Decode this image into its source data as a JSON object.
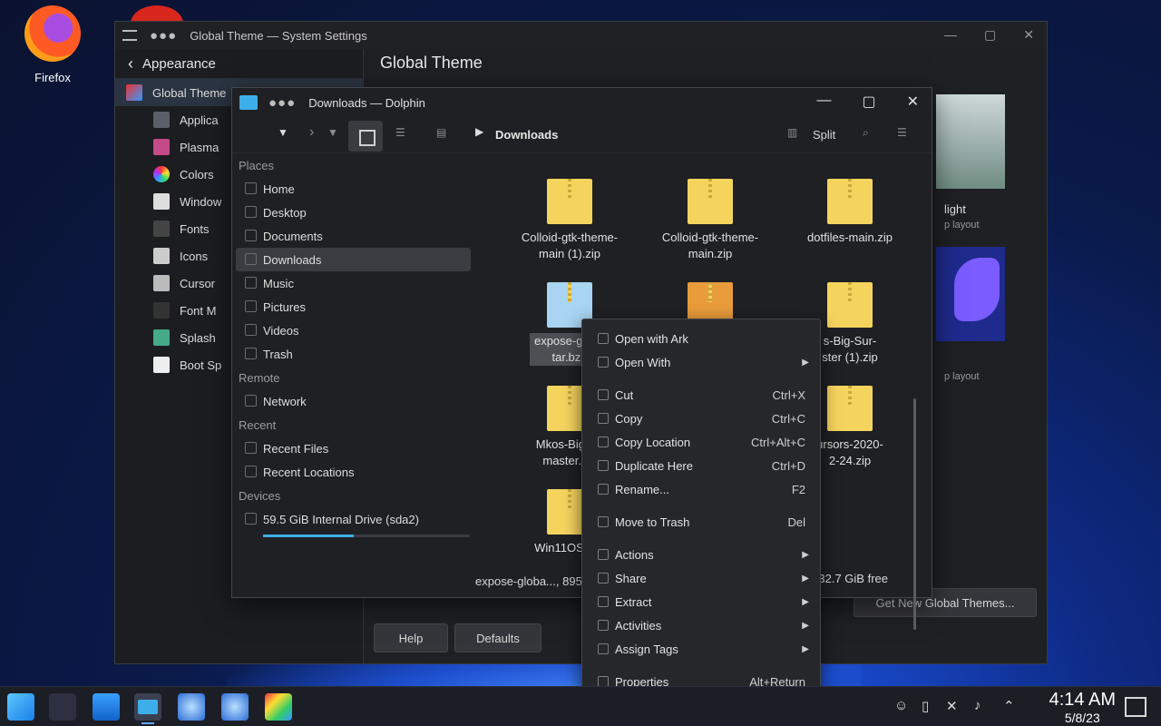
{
  "desktop": {
    "firefox_label": "Firefox"
  },
  "settings_window": {
    "title": "Global Theme — System Settings",
    "sidebar_header": "Appearance",
    "sidebar_items": [
      {
        "label": "Global Theme",
        "selected": true
      },
      {
        "label": "Applica"
      },
      {
        "label": "Plasma"
      },
      {
        "label": "Colors"
      },
      {
        "label": "Window"
      },
      {
        "label": "Fonts"
      },
      {
        "label": "Icons"
      },
      {
        "label": "Cursor"
      },
      {
        "label": "Font M"
      },
      {
        "label": "Splash"
      },
      {
        "label": "Boot Sp"
      }
    ],
    "page_title": "Global Theme",
    "theme1_name": "light",
    "theme1_sub": "p layout",
    "theme2_sub": "p layout",
    "get_new_button": "Get New Global Themes...",
    "help_button": "Help",
    "defaults_button": "Defaults"
  },
  "dolphin": {
    "title": "Downloads — Dolphin",
    "breadcrumb": "Downloads",
    "split_label": "Split",
    "places_header": "Places",
    "places": [
      "Home",
      "Desktop",
      "Documents",
      "Downloads",
      "Music",
      "Pictures",
      "Videos",
      "Trash"
    ],
    "remote_header": "Remote",
    "remote": [
      "Network"
    ],
    "recent_header": "Recent",
    "recent": [
      "Recent Files",
      "Recent Locations"
    ],
    "devices_header": "Devices",
    "devices": [
      "59.5 GiB Internal Drive (sda2)"
    ],
    "drive_usage_fraction": 0.44,
    "files": [
      {
        "line1": "Colloid-gtk-theme-",
        "line2": "main (1).zip"
      },
      {
        "line1": "Colloid-gtk-theme-",
        "line2": "main.zip"
      },
      {
        "line1": "dotfiles-main.zip",
        "line2": ""
      },
      {
        "line1": "expose-globa",
        "line2": "tar.bz2"
      },
      {
        "line1": "",
        "line2": ""
      },
      {
        "line1": "s-Big-Sur-",
        "line2": "ster (1).zip"
      },
      {
        "line1": "Mkos-Big-Su",
        "line2": "master.zip"
      },
      {
        "line1": "ursors-2020-",
        "line2": "2-24.zip"
      },
      {
        "line1": "Win11OS-dar",
        "line2": ""
      }
    ],
    "status_text": "expose-globa..., 895",
    "free_text": "32.7 GiB free"
  },
  "context_menu": {
    "items": [
      {
        "label": "Open with Ark",
        "shortcut": "",
        "submenu": false
      },
      {
        "label": "Open With",
        "shortcut": "",
        "submenu": true
      },
      {
        "label": "Cut",
        "shortcut": "Ctrl+X",
        "submenu": false
      },
      {
        "label": "Copy",
        "shortcut": "Ctrl+C",
        "submenu": false
      },
      {
        "label": "Copy Location",
        "shortcut": "Ctrl+Alt+C",
        "submenu": false
      },
      {
        "label": "Duplicate Here",
        "shortcut": "Ctrl+D",
        "submenu": false
      },
      {
        "label": "Rename...",
        "shortcut": "F2",
        "submenu": false
      },
      {
        "label": "Move to Trash",
        "shortcut": "Del",
        "submenu": false
      },
      {
        "label": "Actions",
        "shortcut": "",
        "submenu": true
      },
      {
        "label": "Share",
        "shortcut": "",
        "submenu": true
      },
      {
        "label": "Extract",
        "shortcut": "",
        "submenu": true
      },
      {
        "label": "Activities",
        "shortcut": "",
        "submenu": true
      },
      {
        "label": "Assign Tags",
        "shortcut": "",
        "submenu": true
      },
      {
        "label": "Properties",
        "shortcut": "Alt+Return",
        "submenu": false
      }
    ]
  },
  "taskbar": {
    "time": "4:14 AM",
    "date": "5/8/23"
  },
  "colors": {
    "accent": "#3daee9",
    "window_bg": "#1f2023",
    "selection": "#3a3c42"
  }
}
